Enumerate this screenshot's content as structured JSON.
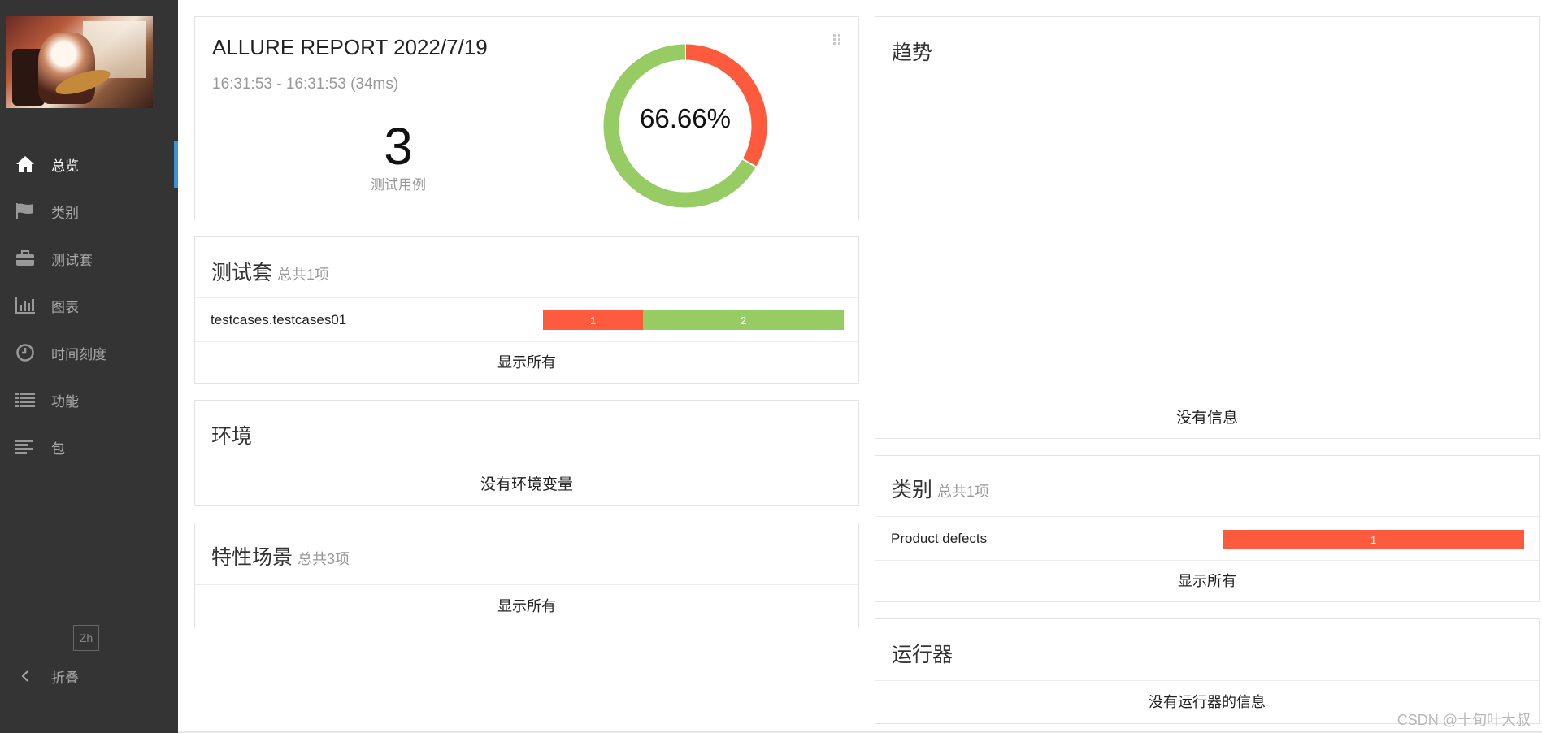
{
  "sidebar": {
    "items": [
      {
        "label": "总览",
        "icon": "home-icon",
        "active": true
      },
      {
        "label": "类别",
        "icon": "flag-icon",
        "active": false
      },
      {
        "label": "测试套",
        "icon": "briefcase-icon",
        "active": false
      },
      {
        "label": "图表",
        "icon": "bar-chart-icon",
        "active": false
      },
      {
        "label": "时间刻度",
        "icon": "clock-icon",
        "active": false
      },
      {
        "label": "功能",
        "icon": "list-icon",
        "active": false
      },
      {
        "label": "包",
        "icon": "align-left-icon",
        "active": false
      }
    ],
    "lang": "Zh",
    "collapse_label": "折叠"
  },
  "summary": {
    "report_title": "ALLURE REPORT 2022/7/19",
    "time_range": "16:31:53 - 16:31:53 (34ms)",
    "test_count": "3",
    "test_count_label": "测试用例",
    "pass_rate": "66.66%",
    "failed": 1,
    "passed": 2
  },
  "suites": {
    "title": "测试套",
    "subtitle": "总共1项",
    "items": [
      {
        "name": "testcases.testcases01",
        "failed": "1",
        "passed": "2"
      }
    ],
    "show_all": "显示所有"
  },
  "environment": {
    "title": "环境",
    "empty": "没有环境变量"
  },
  "features": {
    "title": "特性场景",
    "subtitle": "总共3项",
    "show_all": "显示所有"
  },
  "trend": {
    "title": "趋势",
    "empty": "没有信息"
  },
  "categories": {
    "title": "类别",
    "subtitle": "总共1项",
    "items": [
      {
        "name": "Product defects",
        "count": "1"
      }
    ],
    "show_all": "显示所有"
  },
  "executors": {
    "title": "运行器",
    "empty": "没有运行器的信息"
  },
  "watermark": "CSDN @十旬叶大叔",
  "colors": {
    "failed": "#fd5a3e",
    "passed": "#97cc64",
    "sidebar": "#343434",
    "accent": "#3d8fd6"
  }
}
